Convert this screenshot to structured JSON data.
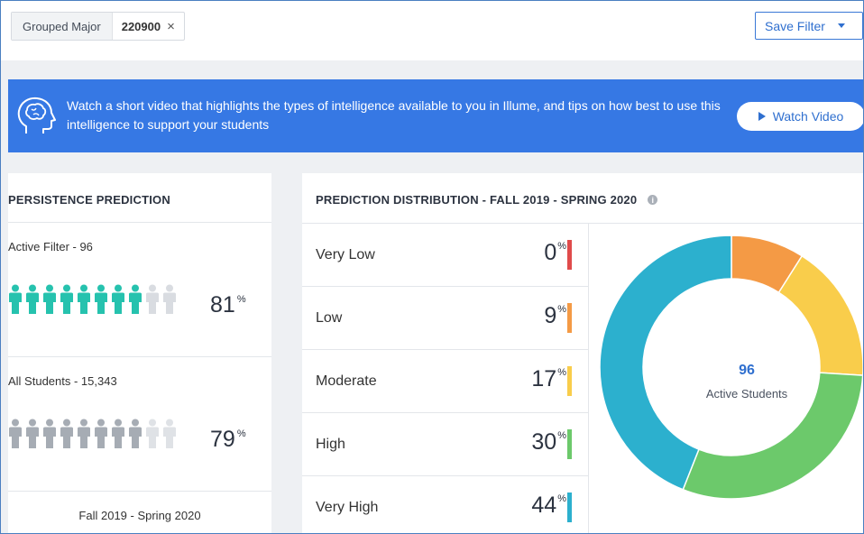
{
  "filter": {
    "chip_key": "Grouped Major",
    "chip_value": "220900",
    "remove_symbol": "×",
    "save_label": "Save Filter"
  },
  "banner": {
    "text": "Watch a short video that highlights the types of intelligence available to you in Illume, and tips on how best to use this intelligence to support your students",
    "button_label": "Watch Video",
    "icon": "head-brain-icon"
  },
  "persistence": {
    "title": "PERSISTENCE PREDICTION",
    "active": {
      "label": "Active Filter - 96",
      "percent": "81",
      "filled_of_10": 8,
      "color": "#26c2ae"
    },
    "all": {
      "label": "All Students - 15,343",
      "percent": "79",
      "filled_of_10": 8,
      "color": "#a6acb4"
    },
    "term": "Fall 2019 - Spring 2020",
    "pct_symbol": "%"
  },
  "distribution": {
    "title": "PREDICTION DISTRIBUTION - FALL 2019 - SPRING 2020",
    "info_icon": "info-icon",
    "tiers": [
      {
        "label": "Very Low",
        "percent": "0",
        "color": "#e04b4b"
      },
      {
        "label": "Low",
        "percent": "9",
        "color": "#f49a45"
      },
      {
        "label": "Moderate",
        "percent": "17",
        "color": "#f9cd4b"
      },
      {
        "label": "High",
        "percent": "30",
        "color": "#6cc96b"
      },
      {
        "label": "Very High",
        "percent": "44",
        "color": "#2cb0ce"
      }
    ],
    "donut": {
      "count": "96",
      "caption": "Active Students"
    }
  }
}
